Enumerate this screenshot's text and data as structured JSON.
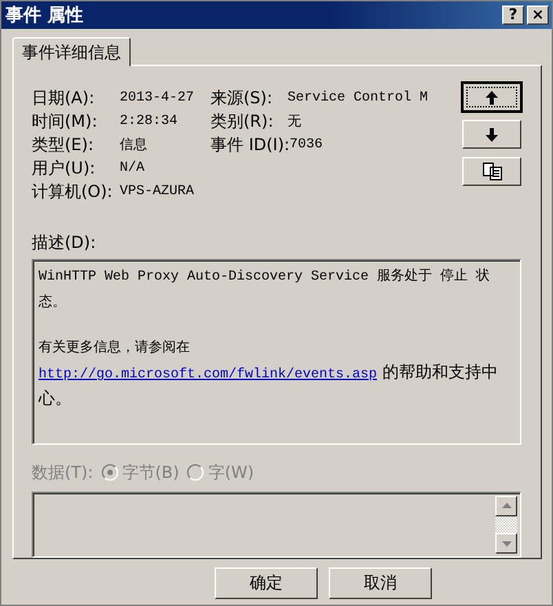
{
  "window": {
    "title": "事件 属性",
    "buttons": [
      "?",
      "×"
    ]
  },
  "tabs": [
    {
      "label": "事件详细信息",
      "selected": true
    }
  ],
  "fields_left": [
    {
      "label": "日期(A):",
      "value": "2013-4-27"
    },
    {
      "label": "时间(M):",
      "value": "2:28:34"
    },
    {
      "label": "类型(E):",
      "value": "信息"
    },
    {
      "label": "用户(U):",
      "value": "N/A"
    },
    {
      "label": "计算机(O):",
      "value": "VPS-AZURA"
    }
  ],
  "fields_right": [
    {
      "label": "来源(S):",
      "value": "Service Control M"
    },
    {
      "label": "类别(R):",
      "value": "无"
    },
    {
      "label": "事件 ID(I):",
      "value": "7036"
    }
  ],
  "side_buttons": [
    {
      "kind": "up",
      "focused": true
    },
    {
      "kind": "down",
      "focused": false
    },
    {
      "kind": "copy",
      "focused": false
    }
  ],
  "description": {
    "label": "描述(D):",
    "paragraphs": [
      {
        "text": "WinHTTP Web Proxy Auto-Discovery Service 服务处于 停止 状态。"
      },
      {
        "text": "有关更多信息，请参阅在",
        "link": "http://go.microsoft.com/fwlink/events.asp",
        "after": "的帮助和支持中心。"
      }
    ]
  },
  "data": {
    "label": "数据(T):",
    "disabled": true,
    "options": [
      {
        "label": "字节(B)",
        "selected": true
      },
      {
        "label": "字(W)",
        "selected": false
      }
    ]
  },
  "buttons": [
    "确定",
    "取消"
  ]
}
